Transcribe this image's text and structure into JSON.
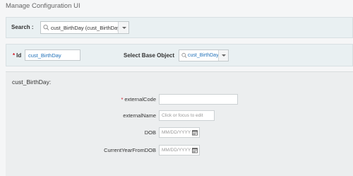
{
  "page": {
    "title": "Manage Configuration UI"
  },
  "search": {
    "label": "Search :",
    "value": "cust_BirthDay (cust_BirthDay)"
  },
  "object": {
    "id_label": "Id",
    "id_value": "cust_BirthDay",
    "base_label": "Select Base Object",
    "base_value": "cust_BirthDay"
  },
  "details": {
    "title": "cust_BirthDay:",
    "fields": [
      {
        "label": "externalCode",
        "required": true,
        "value": ""
      },
      {
        "label": "externalName",
        "required": false,
        "placeholder": "Click or focus to edit"
      },
      {
        "label": "DOB",
        "required": false,
        "placeholder": "MM/DD/YYYY"
      },
      {
        "label": "CurrentYearFromDOB",
        "required": false,
        "placeholder": "MM/DD/YYYY"
      }
    ]
  },
  "colors": {
    "required": "#d0101e",
    "link_value": "#1e6fb8",
    "panel": "#e9f0f2"
  },
  "icons": [
    "search-icon",
    "chevron-down-icon",
    "calendar-icon"
  ]
}
